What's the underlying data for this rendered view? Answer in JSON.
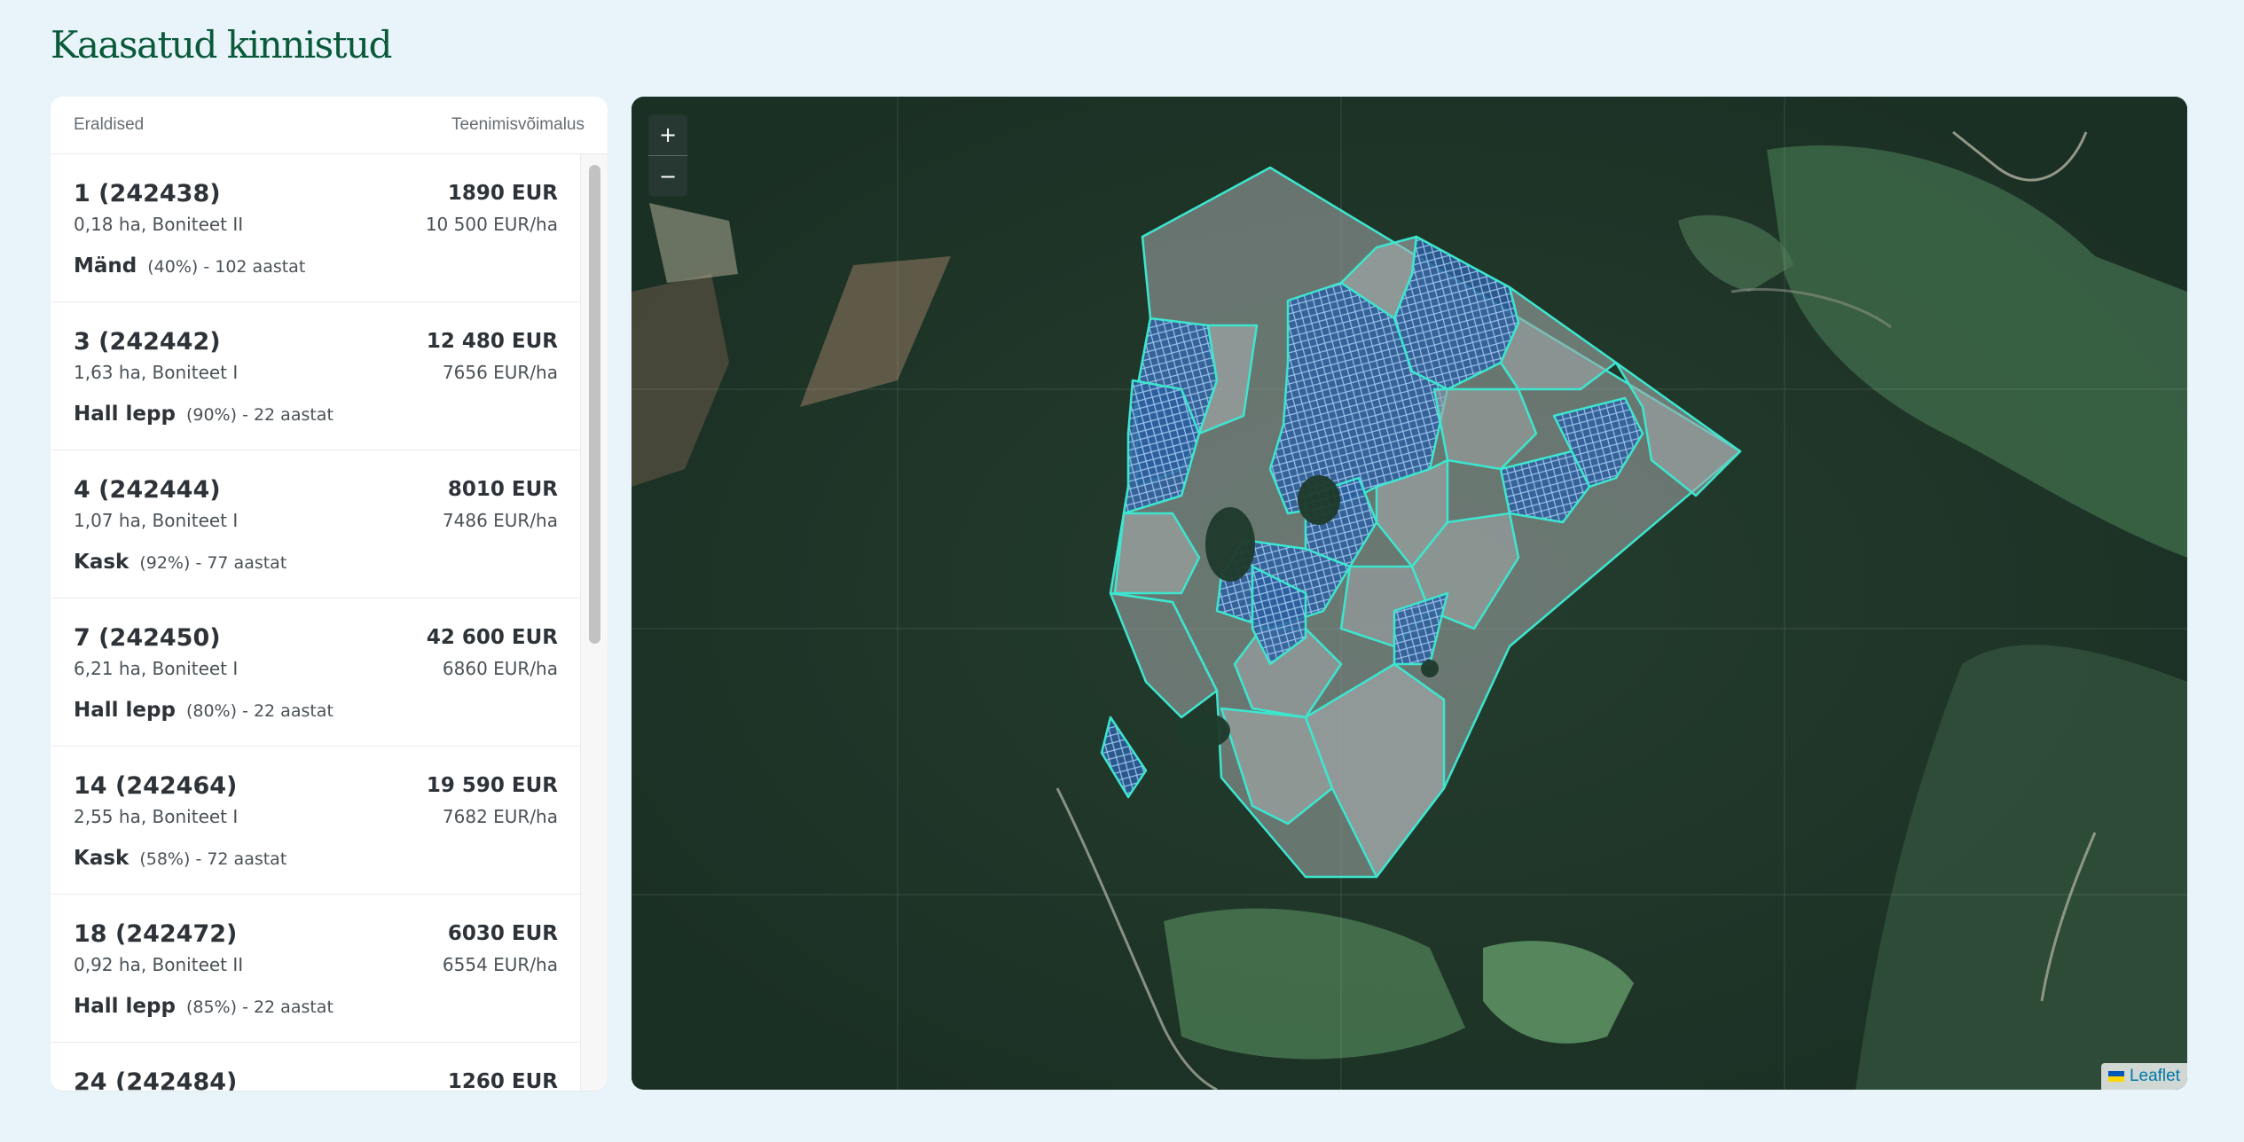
{
  "page": {
    "title": "Kaasatud kinnistud"
  },
  "list": {
    "header_left": "Eraldised",
    "header_right": "Teenimisvõimalus",
    "items": [
      {
        "name": "1 (242438)",
        "area": "0,18 ha, Boniteet II",
        "price": "1890 EUR",
        "price_per_ha": "10 500 EUR/ha",
        "species": "Mänd",
        "detail": "(40%) - 102 aastat"
      },
      {
        "name": "3 (242442)",
        "area": "1,63 ha, Boniteet I",
        "price": "12 480 EUR",
        "price_per_ha": "7656 EUR/ha",
        "species": "Hall lepp",
        "detail": "(90%) - 22 aastat"
      },
      {
        "name": "4 (242444)",
        "area": "1,07 ha, Boniteet I",
        "price": "8010 EUR",
        "price_per_ha": "7486 EUR/ha",
        "species": "Kask",
        "detail": "(92%) - 77 aastat"
      },
      {
        "name": "7 (242450)",
        "area": "6,21 ha, Boniteet I",
        "price": "42 600 EUR",
        "price_per_ha": "6860 EUR/ha",
        "species": "Hall lepp",
        "detail": "(80%) - 22 aastat"
      },
      {
        "name": "14 (242464)",
        "area": "2,55 ha, Boniteet I",
        "price": "19 590 EUR",
        "price_per_ha": "7682 EUR/ha",
        "species": "Kask",
        "detail": "(58%) - 72 aastat"
      },
      {
        "name": "18 (242472)",
        "area": "0,92 ha, Boniteet II",
        "price": "6030 EUR",
        "price_per_ha": "6554 EUR/ha",
        "species": "Hall lepp",
        "detail": "(85%) - 22 aastat"
      },
      {
        "name": "24 (242484)",
        "area": "",
        "price": "1260 EUR",
        "price_per_ha": "",
        "species": "",
        "detail": ""
      }
    ]
  },
  "map": {
    "zoom_in": "+",
    "zoom_out": "−",
    "attribution": "Leaflet",
    "colors": {
      "boundary": "#3de6cf",
      "hatched_fill": "#2c5fa8",
      "gray_fill": "#9aa0a0"
    }
  }
}
